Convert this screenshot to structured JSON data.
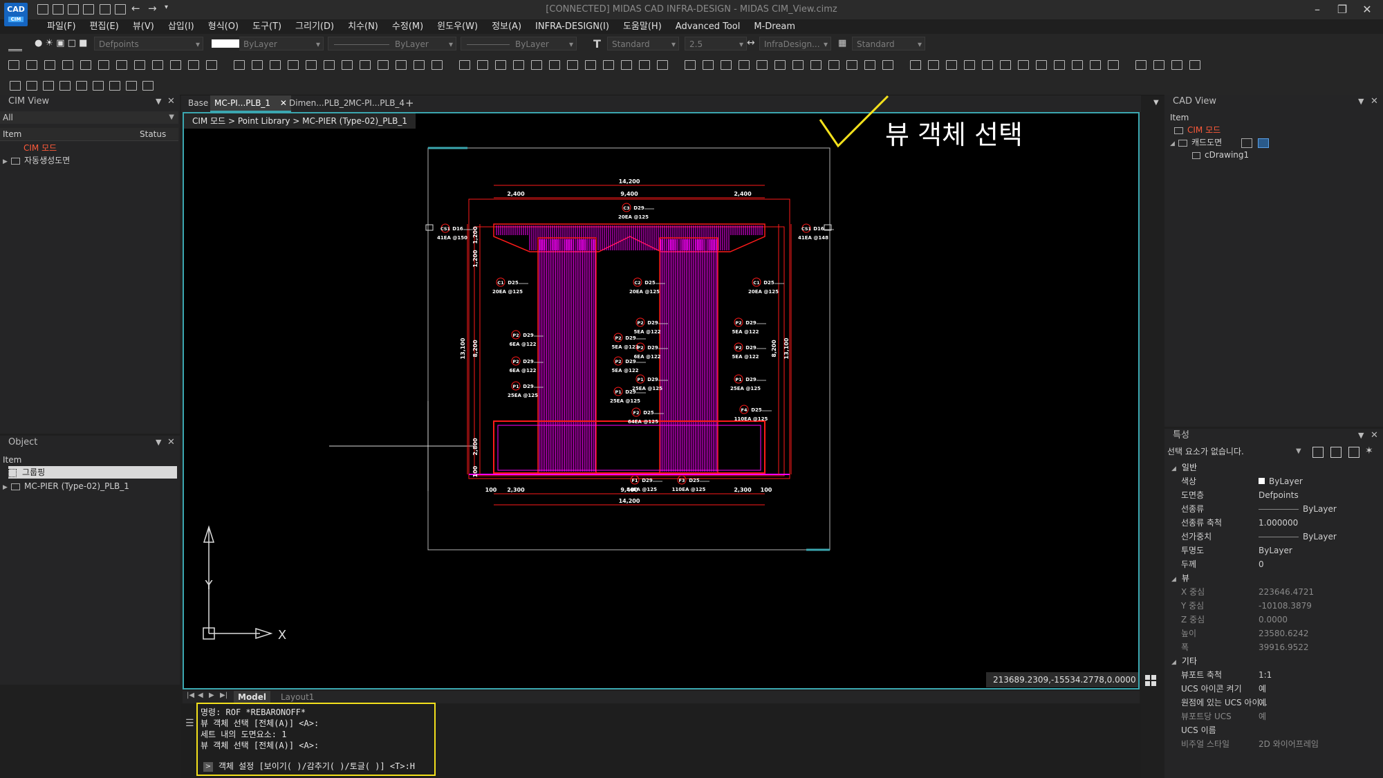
{
  "window": {
    "title": "[CONNECTED] MIDAS CAD INFRA-DESIGN - MIDAS CIM_View.cimz",
    "logo_text": "CAD",
    "logo_sub": "CIM",
    "controls": [
      "–",
      "❐",
      "✕"
    ]
  },
  "menu": [
    "파일(F)",
    "편집(E)",
    "뷰(V)",
    "삽입(I)",
    "형식(O)",
    "도구(T)",
    "그리기(D)",
    "치수(N)",
    "수정(M)",
    "윈도우(W)",
    "정보(A)",
    "INFRA-DESIGN(I)",
    "도움말(H)",
    "Advanced Tool",
    "M-Dream"
  ],
  "toolbar": {
    "layer": "Defpoints",
    "color": "ByLayer",
    "linetype": "ByLayer",
    "lineweight": "ByLayer",
    "text_style": "Standard",
    "text_height": "2.5",
    "dim_style": "InfraDesign...",
    "table_style": "Standard"
  },
  "cim_view": {
    "title": "CIM View",
    "filter": "All",
    "col_item": "Item",
    "col_status": "Status",
    "items": [
      "CIM 모드",
      "자동생성도면"
    ]
  },
  "object_panel": {
    "title": "Object",
    "col_item": "Item",
    "items": [
      "그룹핑",
      "MC-PIER (Type-02)_PLB_1"
    ]
  },
  "tabs": [
    "Base",
    "MC-PI...PLB_1",
    "Dimen...PLB_2",
    "MC-PI...PLB_4"
  ],
  "breadcrumb": "CIM 모드 > Point Library > MC-PIER (Type-02)_PLB_1",
  "annotation": "뷰 객체 선택",
  "coordinates": "213689.2309,-15534.2778,0.0000",
  "drawing": {
    "dims_top": [
      "14,200",
      "2,400",
      "9,400",
      "2,400"
    ],
    "dims_bottom": [
      "100",
      "2,300",
      "9,400",
      "2,300",
      "100",
      "14,200"
    ],
    "dims_side": [
      "13,100",
      "8,200",
      "1,200",
      "1,200",
      "2,800",
      "100",
      "13,100",
      "8,200"
    ],
    "labels": [
      {
        "id": "C3",
        "bar": "D29",
        "qty": "20EA @125"
      },
      {
        "id": "CS1",
        "bar": "D16",
        "qty": "41EA @150"
      },
      {
        "id": "CS1",
        "bar": "D16",
        "qty": "41EA @148"
      },
      {
        "id": "C1",
        "bar": "D25",
        "qty": "20EA @125"
      },
      {
        "id": "C2",
        "bar": "D25",
        "qty": "20EA @125"
      },
      {
        "id": "C1",
        "bar": "D25",
        "qty": "20EA @125"
      },
      {
        "id": "P2",
        "bar": "D29",
        "qty": "6EA @122"
      },
      {
        "id": "P2",
        "bar": "D29",
        "qty": "5EA @122"
      },
      {
        "id": "P2",
        "bar": "D29",
        "qty": "5EA @122"
      },
      {
        "id": "P2",
        "bar": "D29",
        "qty": "5EA @122"
      },
      {
        "id": "P2",
        "bar": "D29",
        "qty": "6EA @122"
      },
      {
        "id": "P2",
        "bar": "D29",
        "qty": "5EA @122"
      },
      {
        "id": "P2",
        "bar": "D29",
        "qty": "6EA @122"
      },
      {
        "id": "P2",
        "bar": "D29",
        "qty": "5EA @122"
      },
      {
        "id": "P1",
        "bar": "D29",
        "qty": "25EA @125"
      },
      {
        "id": "P1",
        "bar": "D29",
        "qty": "25EA @125"
      },
      {
        "id": "P1",
        "bar": "D29",
        "qty": "25EA @125"
      },
      {
        "id": "P1",
        "bar": "D29",
        "qty": "25EA @125"
      },
      {
        "id": "F2",
        "bar": "D25",
        "qty": "64EA @125"
      },
      {
        "id": "F4",
        "bar": "D25",
        "qty": "110EA @125"
      },
      {
        "id": "F1",
        "bar": "D29",
        "qty": "84EA @125"
      },
      {
        "id": "F3",
        "bar": "D25",
        "qty": "110EA @125"
      }
    ]
  },
  "layout_tabs": [
    "Model",
    "Layout1"
  ],
  "command": {
    "lines": [
      "명령: ROF *REBARONOFF*",
      "뷰 객체 선택 [전체(A)] <A>:",
      "세트 내의 도면요소: 1",
      "뷰 객체 선택 [전체(A)] <A>:"
    ],
    "prompt": "객체 설정 [보이기(  )/감추기(  )/토글(  )] <T>:H"
  },
  "cad_view": {
    "title": "CAD View",
    "col_item": "Item",
    "items": [
      "CIM 모드",
      "캐드도면",
      "cDrawing1"
    ]
  },
  "properties": {
    "title": "특성",
    "selection": "선택 요소가 없습니다.",
    "sections": [
      {
        "name": "일반",
        "rows": [
          {
            "k": "색상",
            "v": "ByLayer"
          },
          {
            "k": "도면층",
            "v": "Defpoints"
          },
          {
            "k": "선종류",
            "v": "ByLayer"
          },
          {
            "k": "선종류 축척",
            "v": "1.000000"
          },
          {
            "k": "선가중치",
            "v": "ByLayer"
          },
          {
            "k": "투명도",
            "v": "ByLayer"
          },
          {
            "k": "두께",
            "v": "0"
          }
        ]
      },
      {
        "name": "뷰",
        "rows": [
          {
            "k": "X 중심",
            "v": "223646.4721"
          },
          {
            "k": "Y 중심",
            "v": "-10108.3879"
          },
          {
            "k": "Z 중심",
            "v": "0.0000"
          },
          {
            "k": "높이",
            "v": "23580.6242"
          },
          {
            "k": "폭",
            "v": "39916.9522"
          }
        ]
      },
      {
        "name": "기타",
        "rows": [
          {
            "k": "뷰포트 축척",
            "v": "1:1"
          },
          {
            "k": "UCS 아이콘 켜기",
            "v": "예"
          },
          {
            "k": "원점에 있는 UCS 아이...",
            "v": "예"
          },
          {
            "k": "뷰포트당 UCS",
            "v": "예"
          },
          {
            "k": "UCS 이름",
            "v": ""
          },
          {
            "k": "비주얼 스타일",
            "v": "2D 와이어프레임"
          }
        ]
      }
    ]
  },
  "axis": {
    "x": "X",
    "y": "Y"
  },
  "colors": {
    "accent": "#3ba7b0",
    "highlight": "#f4e11c",
    "rebar": "#ff00ff",
    "outline": "#ff1a1a",
    "cim_mode": "#ff5a3a"
  }
}
